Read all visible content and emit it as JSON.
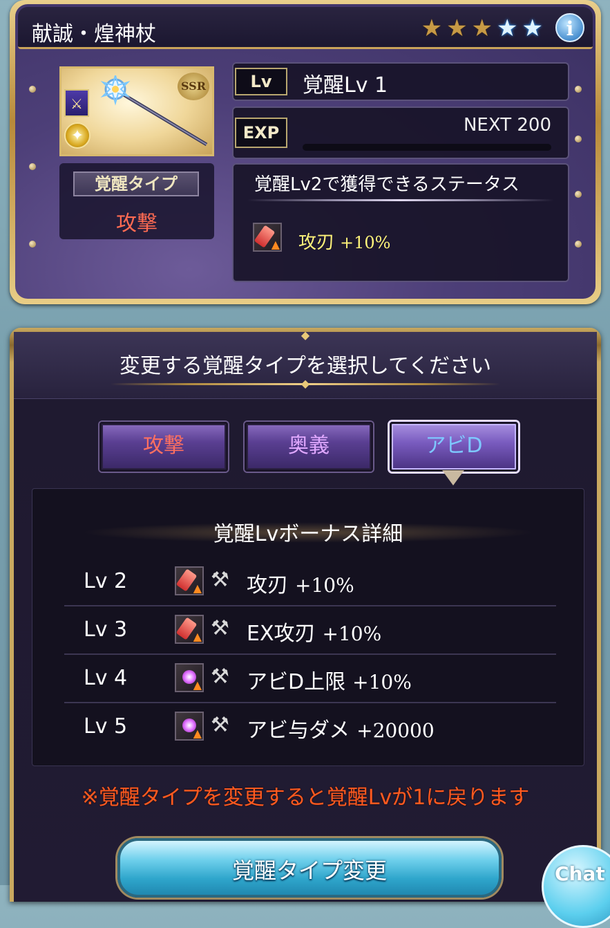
{
  "weapon": {
    "name": "献誠・煌神杖",
    "rarity_badge": "SSR",
    "rank_stars": [
      "gold",
      "gold",
      "gold",
      "blue",
      "blue"
    ]
  },
  "level": {
    "tag": "Lv",
    "text": "覚醒Lv 1"
  },
  "exp": {
    "tag": "EXP",
    "next_text": "NEXT 200",
    "progress": 0.0
  },
  "awaken_type": {
    "label": "覚醒タイプ",
    "value": "攻撃"
  },
  "next_status": {
    "heading": "覚醒Lv2で獲得できるステータス",
    "name": "攻刃",
    "value": "+10%"
  },
  "dialog": {
    "title": "変更する覚醒タイプを選択してください",
    "tabs": [
      {
        "label": "攻撃",
        "color": "#ff7060"
      },
      {
        "label": "奥義",
        "color": "#e0a8ff"
      },
      {
        "label": "アビD",
        "color": "#7ec8ff"
      }
    ],
    "selected_tab": "アビD",
    "bonus_title": "覚醒Lvボーナス詳細",
    "bonus_rows": [
      {
        "lv": "Lv 2",
        "name": "攻刃",
        "value": "+10%",
        "icon": "attack-up-icon"
      },
      {
        "lv": "Lv 3",
        "name": "EX攻刃",
        "value": "+10%",
        "icon": "attack-up-icon"
      },
      {
        "lv": "Lv 4",
        "name": "アビD上限",
        "value": "+10%",
        "icon": "ability-up-icon"
      },
      {
        "lv": "Lv 5",
        "name": "アビ与ダメ",
        "value": "+20000",
        "icon": "ability-up-icon"
      }
    ],
    "warning": "※覚醒タイプを変更すると覚醒Lvが1に戻ります",
    "change_button": "覚醒タイプ変更"
  },
  "chat_label": "Chat",
  "colors": {
    "frame_gold": "#caa45a",
    "card_purple": "#4d3f78",
    "warning_orange": "#ff5a20",
    "status_yellow": "#fff47a"
  }
}
